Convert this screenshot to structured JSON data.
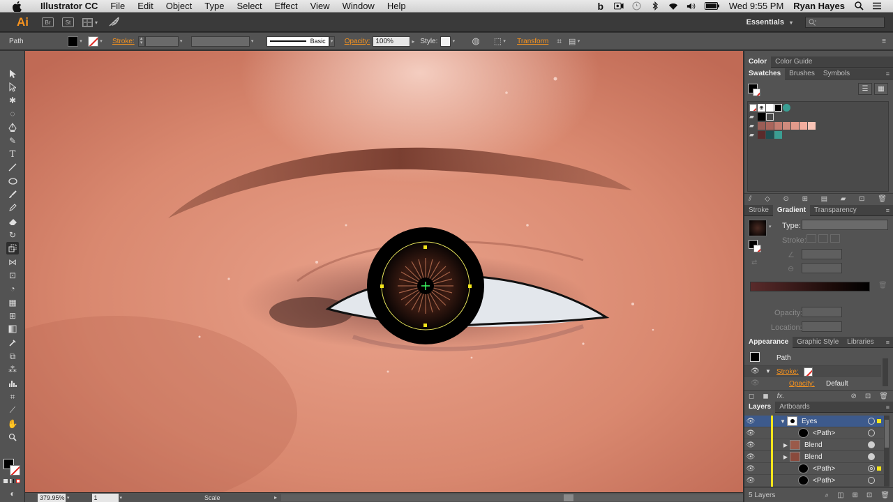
{
  "menubar": {
    "app": "Illustrator CC",
    "items": [
      "File",
      "Edit",
      "Object",
      "Type",
      "Select",
      "Effect",
      "View",
      "Window",
      "Help"
    ],
    "clock": "Wed 9:55 PM",
    "user": "Ryan Hayes"
  },
  "appbar": {
    "logo": "Ai",
    "bridge": "Br",
    "stock": "St",
    "workspace": "Essentials"
  },
  "control": {
    "selection": "Path",
    "stroke_label": "Stroke:",
    "brush": "Basic",
    "opacity_label": "Opacity:",
    "opacity_value": "100%",
    "style_label": "Style:",
    "transform": "Transform"
  },
  "status": {
    "zoom": "379.95%",
    "artboard": "1",
    "tool": "Scale"
  },
  "panels": {
    "color_tabs": [
      "Color",
      "Color Guide"
    ],
    "swatch_tabs": [
      "Swatches",
      "Brushes",
      "Symbols"
    ],
    "gradient_tabs": [
      "Stroke",
      "Gradient",
      "Transparency"
    ],
    "gradient": {
      "type_label": "Type:",
      "stroke_label": "Stroke:",
      "opacity_label": "Opacity:",
      "location_label": "Location:"
    },
    "appearance_tabs": [
      "Appearance",
      "Graphic Style",
      "Libraries"
    ],
    "appearance": {
      "title": "Path",
      "stroke": "Stroke:",
      "opacity": "Opacity:",
      "opacity_value": "Default"
    },
    "layers_tabs": [
      "Layers",
      "Artboards"
    ],
    "layers": [
      {
        "name": "Eyes",
        "level": 0,
        "expanded": true
      },
      {
        "name": "<Path>",
        "level": 1,
        "expanded": false
      },
      {
        "name": "Blend",
        "level": 1,
        "expanded": false
      },
      {
        "name": "Blend",
        "level": 1,
        "expanded": false
      },
      {
        "name": "<Path>",
        "level": 1,
        "expanded": false
      },
      {
        "name": "<Path>",
        "level": 1,
        "expanded": false
      }
    ],
    "layers_count": "5 Layers"
  },
  "colors": {
    "accent": "#f7931e",
    "layer_bar": "#f4e51b",
    "selection_blue": "#3d5a8c"
  }
}
